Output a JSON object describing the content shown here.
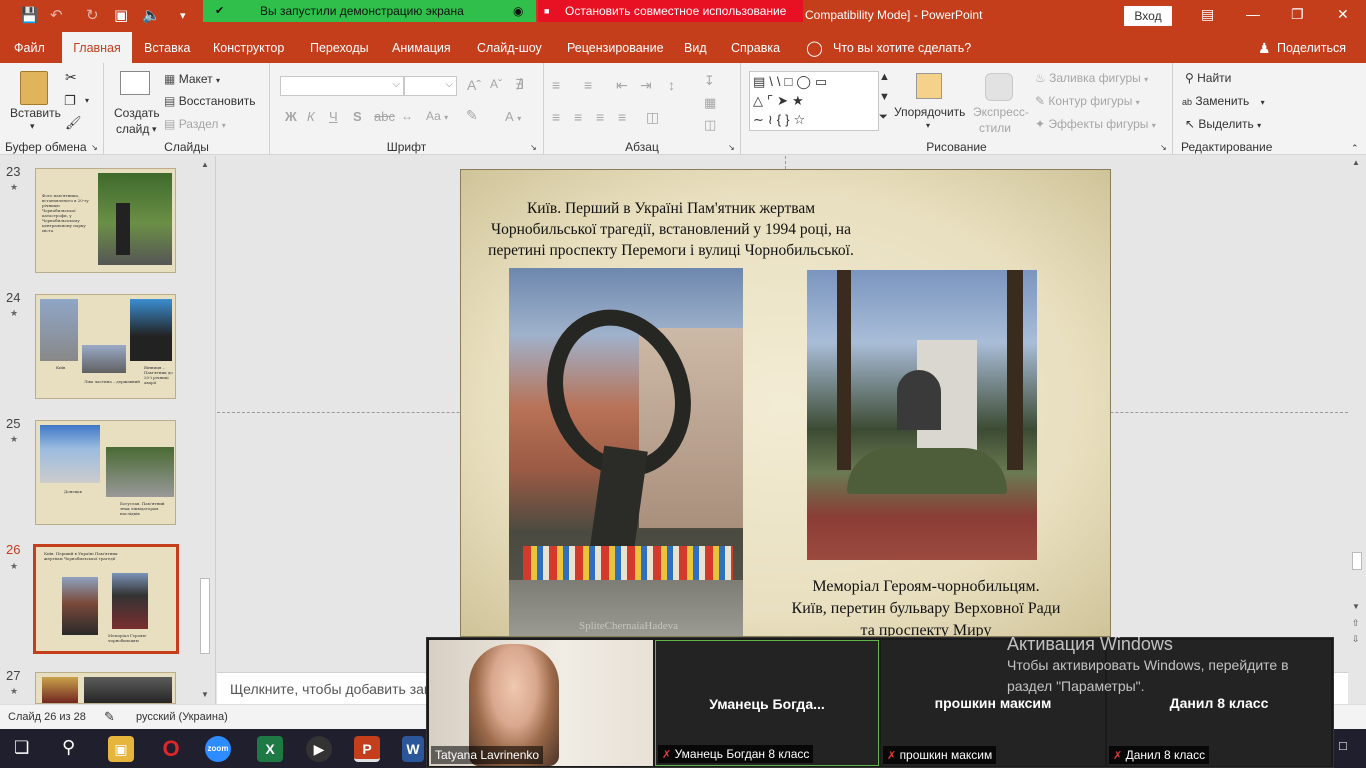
{
  "app": {
    "doc_title": "Compatibility Mode]  -  PowerPoint",
    "sign_in": "Вход"
  },
  "share_bar": {
    "status": "Вы запустили демонстрацию экрана",
    "stop": "Остановить совместное использование"
  },
  "tabs": [
    "Файл",
    "Главная",
    "Вставка",
    "Конструктор",
    "Переходы",
    "Анимация",
    "Слайд-шоу",
    "Рецензирование",
    "Вид",
    "Справка"
  ],
  "tell_me": "Что вы хотите сделать?",
  "share": "Поделиться",
  "ribbon": {
    "clipboard": {
      "paste": "Вставить",
      "label": "Буфер обмена"
    },
    "slides": {
      "new_slide_1": "Создать",
      "new_slide_2": "слайд",
      "layout": "Макет",
      "reset": "Восстановить",
      "section": "Раздел",
      "label": "Слайды"
    },
    "font": {
      "label": "Шрифт",
      "bold": "Ж",
      "italic": "К",
      "underline": "Ч",
      "strike": "S",
      "case": "Аа",
      "color": "А"
    },
    "paragraph": {
      "label": "Абзац"
    },
    "drawing": {
      "arrange_1": "Упорядочить",
      "styles_1": "Экспресс-",
      "styles_2": "стили",
      "fill": "Заливка фигуры",
      "outline": "Контур фигуры",
      "effects": "Эффекты фигуры",
      "label": "Рисование"
    },
    "editing": {
      "find": "Найти",
      "replace": "Заменить",
      "select": "Выделить",
      "label": "Редактирование"
    }
  },
  "thumbnails": [
    {
      "num": "23",
      "caption": "Фото пам'ятника, встановленого в 20-ту річницю Чорнобильської катастрофи, у Чорнобильському центральному парку міста"
    },
    {
      "num": "24",
      "caption_a": "Київ",
      "caption_b": "Ліва частина – державний",
      "caption_c": "Вінниця – Пам'ятник до 20-ї річниці аварії"
    },
    {
      "num": "25",
      "caption_a": "Донецьк",
      "caption_b": "Богуслав. Пам'ятний знак ліквідаторам наслідків"
    },
    {
      "num": "26",
      "caption_a": "Київ. Перший в Україні Пам'ятник жертвам Чорнобильської трагедії",
      "caption_b": "Меморіал Героям-чорнобильцям"
    },
    {
      "num": "27"
    }
  ],
  "slide": {
    "title_line1": "Київ. Перший в Україні Пам'ятник жертвам",
    "title_line2": "Чорнобильської трагедії, встановлений у 1994 році, на",
    "title_line3": "перетині проспекту Перемоги і вулиці Чорнобильської.",
    "caption_line1": "Меморіал Героям-чорнобильцям.",
    "caption_line2": "Київ, перетин бульвару Верховної Ради",
    "caption_line3": "та проспекту Миру",
    "watermark": "SpliteChernaiaHadeva"
  },
  "notes_placeholder": "Щелкните, чтобы добавить заметки",
  "status": {
    "slide_of": "Слайд 26 из 28",
    "language": "русский (Украина)"
  },
  "zoom": {
    "self_name": "Tatyana Lavrinenko",
    "participants": [
      {
        "tile": "Уманець  Богда...",
        "label": "Уманець Богдан 8 класс"
      },
      {
        "tile": "прошкин максим",
        "label": "прошкин максим"
      },
      {
        "tile": "Данил 8 класс",
        "label": "Данил 8 класс"
      }
    ]
  },
  "activation": {
    "title": "Активация Windows",
    "line1": "Чтобы активировать Windows, перейдите в",
    "line2": "раздел \"Параметры\"."
  },
  "taskbar": {
    "zoom_label": "zoom"
  },
  "colors": {
    "accent": "#c43e1c",
    "share_green": "#2fbf4a",
    "share_red": "#e81123"
  }
}
